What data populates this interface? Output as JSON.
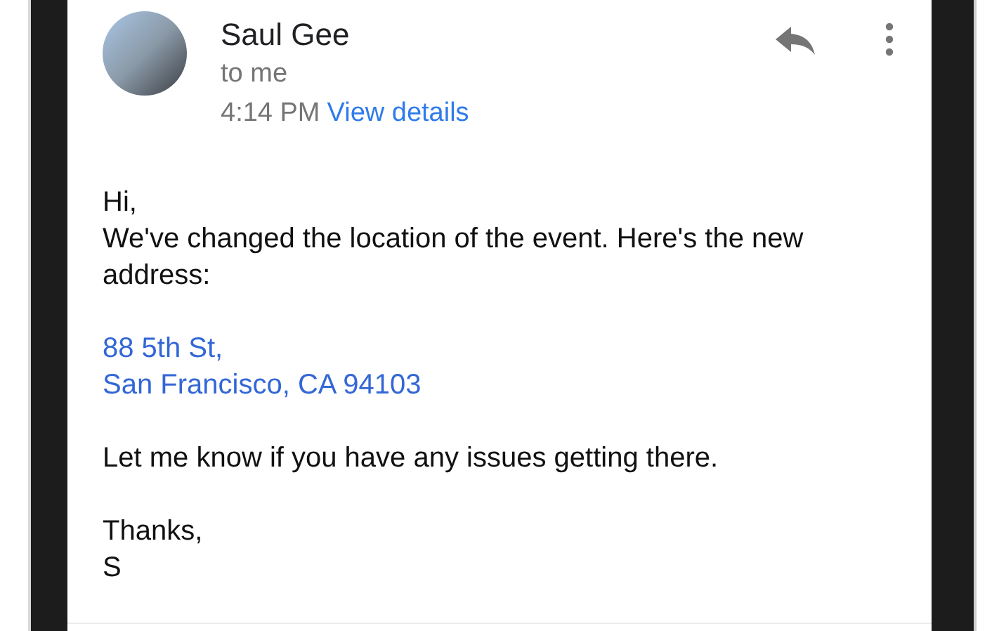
{
  "message": {
    "sender": "Saul Gee",
    "recipient": "to me",
    "time": "4:14 PM",
    "details_link": "View details"
  },
  "body": [
    {
      "kind": "text",
      "lines": [
        "Hi,",
        "We've changed the location of the event. Here's the new address:"
      ]
    },
    {
      "kind": "link",
      "lines": [
        "88 5th St,",
        "San Francisco, CA 94103"
      ]
    },
    {
      "kind": "text",
      "lines": [
        "Let me know if you have any issues getting there."
      ]
    },
    {
      "kind": "text",
      "lines": [
        "Thanks,",
        "S"
      ]
    }
  ]
}
